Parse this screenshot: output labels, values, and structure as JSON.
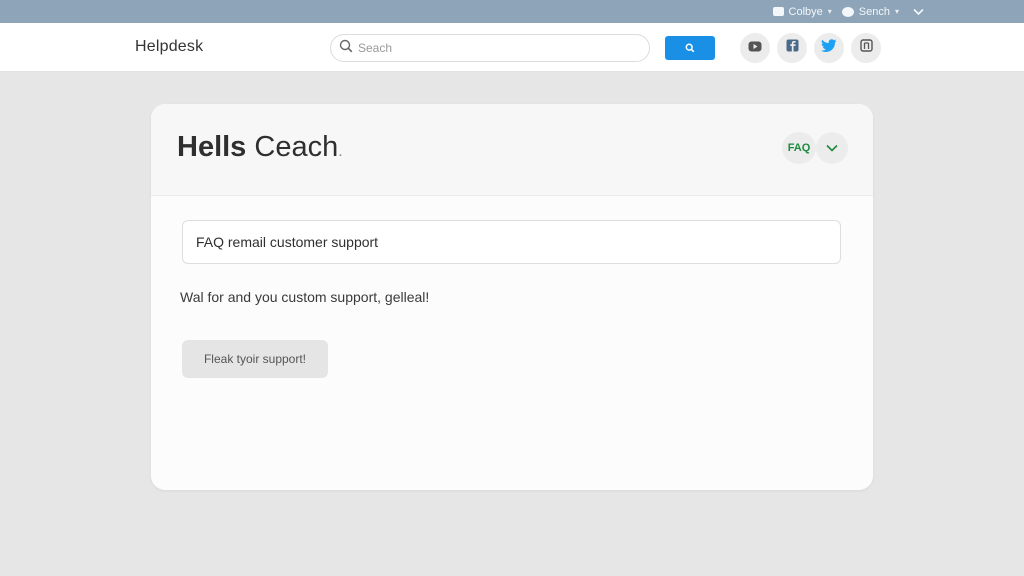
{
  "topbar": {
    "item1_label": "Colbye",
    "item2_label": "Sench",
    "icons": [
      "chat-icon",
      "cloud-icon",
      "chevron-down-icon"
    ]
  },
  "header": {
    "brand": "Helpdesk",
    "search_placeholder": "Seach",
    "search_button_icon": "search-icon",
    "social_icons": [
      "youtube-icon",
      "facebook-icon",
      "twitter-icon",
      "instagram-icon"
    ]
  },
  "card": {
    "title_bold": "Hells",
    "title_light": "Ceach",
    "title_dot": ".",
    "badge": "FAQ",
    "input_value": "FAQ remail customer support",
    "message": "Wal for and you custom support, gelleal!",
    "button_label": "Fleak tyoir support!"
  },
  "colors": {
    "topbar": "#8ea4b8",
    "accent": "#1a8fe6",
    "badge_text": "#1e8a3c",
    "twitter": "#1da1f2",
    "background": "#e6e6e6"
  }
}
